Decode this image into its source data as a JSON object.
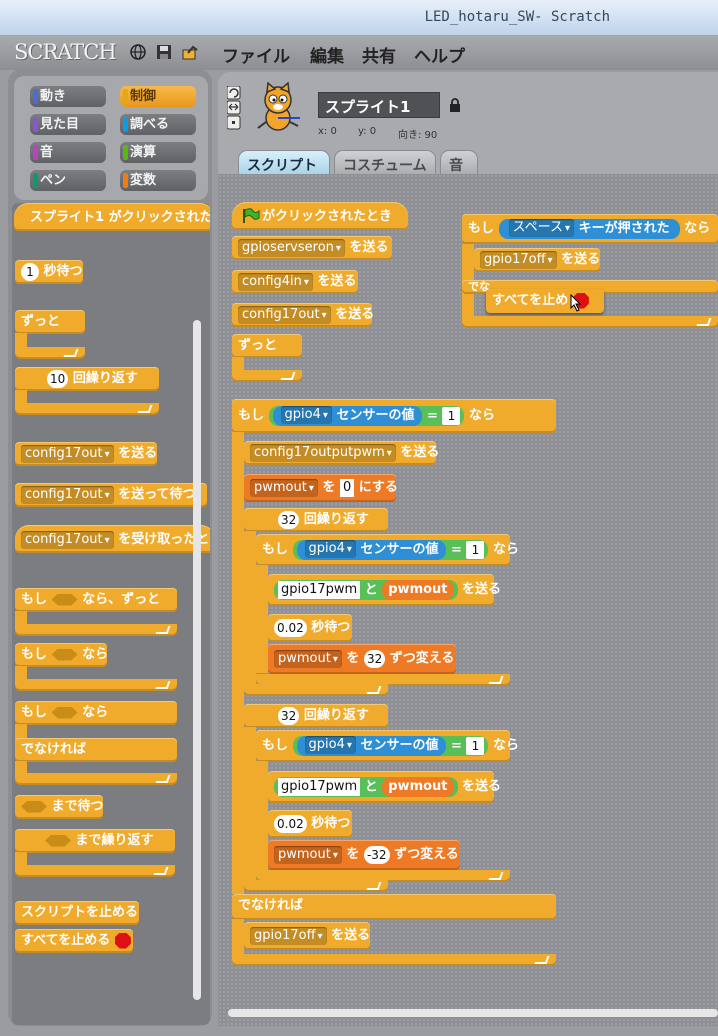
{
  "window": {
    "title": "LED_hotaru_SW- Scratch"
  },
  "menubar": {
    "logo": "SCRATCH",
    "items": [
      "ファイル",
      "編集",
      "共有",
      "ヘルプ"
    ]
  },
  "categories": [
    {
      "label": "動き",
      "color": "#4a6cd4"
    },
    {
      "label": "制御",
      "color": "#e1a91a"
    },
    {
      "label": "見た目",
      "color": "#8a55d7"
    },
    {
      "label": "調べる",
      "color": "#0e9ae5"
    },
    {
      "label": "音",
      "color": "#bb42c3"
    },
    {
      "label": "演算",
      "color": "#5cb712"
    },
    {
      "label": "ペン",
      "color": "#0e9a6c"
    },
    {
      "label": "変数",
      "color": "#ee7d16"
    }
  ],
  "palette": {
    "when_clicked": "スプライト1 がクリックされた",
    "wait_val": "1",
    "wait_label": "秒待つ",
    "forever": "ずっと",
    "repeat_val": "10",
    "repeat_label": "回繰り返す",
    "broadcast_msg": "config17out",
    "broadcast_label": "を送る",
    "broadcast_wait_msg": "config17out",
    "broadcast_wait_label": "を送って待つ",
    "receive_msg": "config17out",
    "receive_label": "を受け取ったと",
    "forever_if_a": "もし",
    "forever_if_b": "なら、ずっと",
    "if_a": "もし",
    "if_b": "なら",
    "ifelse_a": "もし",
    "ifelse_b": "なら",
    "else_label": "でなければ",
    "wait_until": "まで待つ",
    "repeat_until": "まで繰り返す",
    "stop_script": "スクリプトを止める",
    "stop_all": "すべてを止める"
  },
  "sprite": {
    "name": "スプライト1",
    "x_label": "x: 0",
    "y_label": "y: 0",
    "dir_label": "向き: 90"
  },
  "tabs": [
    "スクリプト",
    "コスチューム",
    "音"
  ],
  "script1": {
    "hat": "がクリックされたとき",
    "b1": "gpioservseron",
    "b2": "config4in",
    "b3": "config17out",
    "send": "を送る",
    "forever": "ずっと"
  },
  "script2": {
    "if": "もし",
    "key": "スペース",
    "key_label": "キーが押された",
    "then": "なら",
    "msg": "gpio17off",
    "send": "を送る",
    "else_partial": "でな",
    "stop_all": "すべてを止め"
  },
  "script3": {
    "if": "もし",
    "sensor": "gpio4",
    "sensor_label": "センサーの値",
    "eq": "=",
    "eq_val": "1",
    "then": "なら",
    "msg1": "config17outputpwm",
    "send": "を送る",
    "var": "pwmout",
    "set_to": "を",
    "set_val": "0",
    "set_label": "にする",
    "rep1_val": "32",
    "rep_label": "回繰り返す",
    "join_text": "gpio17pwm",
    "join_and": "と",
    "join_var": "pwmout",
    "wait_val": "0.02",
    "wait_label": "秒待つ",
    "change_val1": "32",
    "change_label": "ずつ変える",
    "rep2_val": "32",
    "change_val2": "-32",
    "else": "でなければ",
    "msg_off": "gpio17off"
  }
}
